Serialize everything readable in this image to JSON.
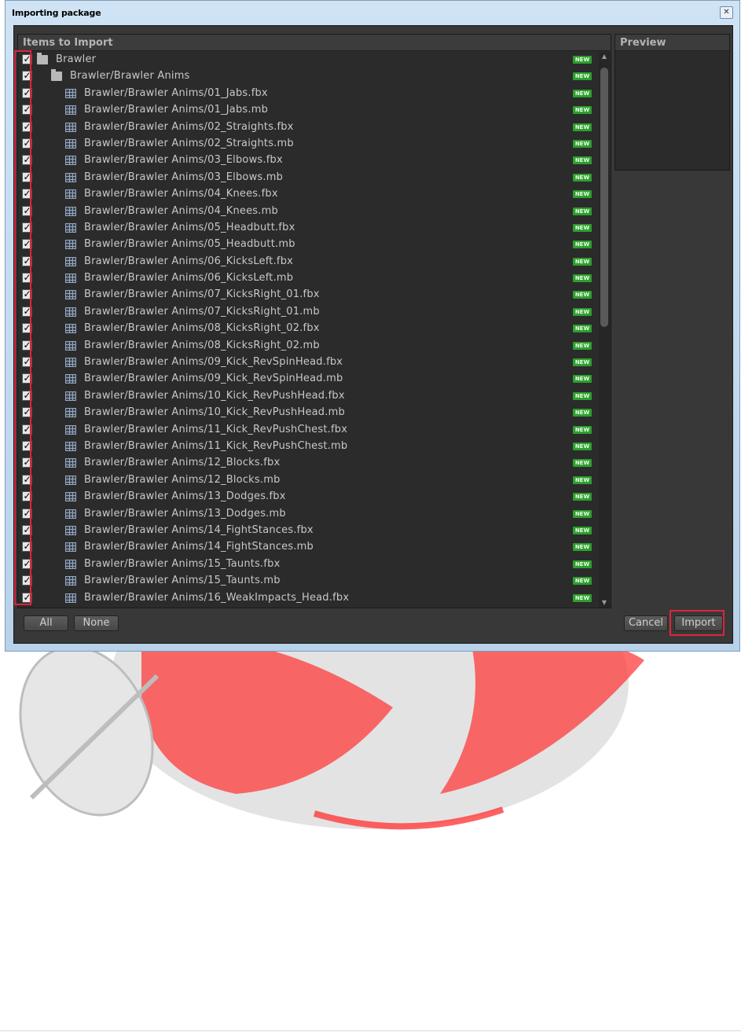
{
  "window": {
    "title": "Importing package",
    "close_glyph": "✕"
  },
  "items_panel": {
    "header": "Items to Import",
    "badge_text": "NEW"
  },
  "preview_panel": {
    "header": "Preview"
  },
  "items": [
    {
      "label": "Brawler",
      "type": "folder",
      "depth": 0,
      "checked": true
    },
    {
      "label": "Brawler/Brawler Anims",
      "type": "folder",
      "depth": 1,
      "checked": true
    },
    {
      "label": "Brawler/Brawler Anims/01_Jabs.fbx",
      "type": "file",
      "depth": 2,
      "checked": true
    },
    {
      "label": "Brawler/Brawler Anims/01_Jabs.mb",
      "type": "file",
      "depth": 2,
      "checked": true
    },
    {
      "label": "Brawler/Brawler Anims/02_Straights.fbx",
      "type": "file",
      "depth": 2,
      "checked": true
    },
    {
      "label": "Brawler/Brawler Anims/02_Straights.mb",
      "type": "file",
      "depth": 2,
      "checked": true
    },
    {
      "label": "Brawler/Brawler Anims/03_Elbows.fbx",
      "type": "file",
      "depth": 2,
      "checked": true
    },
    {
      "label": "Brawler/Brawler Anims/03_Elbows.mb",
      "type": "file",
      "depth": 2,
      "checked": true
    },
    {
      "label": "Brawler/Brawler Anims/04_Knees.fbx",
      "type": "file",
      "depth": 2,
      "checked": true
    },
    {
      "label": "Brawler/Brawler Anims/04_Knees.mb",
      "type": "file",
      "depth": 2,
      "checked": true
    },
    {
      "label": "Brawler/Brawler Anims/05_Headbutt.fbx",
      "type": "file",
      "depth": 2,
      "checked": true
    },
    {
      "label": "Brawler/Brawler Anims/05_Headbutt.mb",
      "type": "file",
      "depth": 2,
      "checked": true
    },
    {
      "label": "Brawler/Brawler Anims/06_KicksLeft.fbx",
      "type": "file",
      "depth": 2,
      "checked": true
    },
    {
      "label": "Brawler/Brawler Anims/06_KicksLeft.mb",
      "type": "file",
      "depth": 2,
      "checked": true
    },
    {
      "label": "Brawler/Brawler Anims/07_KicksRight_01.fbx",
      "type": "file",
      "depth": 2,
      "checked": true
    },
    {
      "label": "Brawler/Brawler Anims/07_KicksRight_01.mb",
      "type": "file",
      "depth": 2,
      "checked": true
    },
    {
      "label": "Brawler/Brawler Anims/08_KicksRight_02.fbx",
      "type": "file",
      "depth": 2,
      "checked": true
    },
    {
      "label": "Brawler/Brawler Anims/08_KicksRight_02.mb",
      "type": "file",
      "depth": 2,
      "checked": true
    },
    {
      "label": "Brawler/Brawler Anims/09_Kick_RevSpinHead.fbx",
      "type": "file",
      "depth": 2,
      "checked": true
    },
    {
      "label": "Brawler/Brawler Anims/09_Kick_RevSpinHead.mb",
      "type": "file",
      "depth": 2,
      "checked": true
    },
    {
      "label": "Brawler/Brawler Anims/10_Kick_RevPushHead.fbx",
      "type": "file",
      "depth": 2,
      "checked": true
    },
    {
      "label": "Brawler/Brawler Anims/10_Kick_RevPushHead.mb",
      "type": "file",
      "depth": 2,
      "checked": true
    },
    {
      "label": "Brawler/Brawler Anims/11_Kick_RevPushChest.fbx",
      "type": "file",
      "depth": 2,
      "checked": true
    },
    {
      "label": "Brawler/Brawler Anims/11_Kick_RevPushChest.mb",
      "type": "file",
      "depth": 2,
      "checked": true
    },
    {
      "label": "Brawler/Brawler Anims/12_Blocks.fbx",
      "type": "file",
      "depth": 2,
      "checked": true
    },
    {
      "label": "Brawler/Brawler Anims/12_Blocks.mb",
      "type": "file",
      "depth": 2,
      "checked": true
    },
    {
      "label": "Brawler/Brawler Anims/13_Dodges.fbx",
      "type": "file",
      "depth": 2,
      "checked": true
    },
    {
      "label": "Brawler/Brawler Anims/13_Dodges.mb",
      "type": "file",
      "depth": 2,
      "checked": true
    },
    {
      "label": "Brawler/Brawler Anims/14_FightStances.fbx",
      "type": "file",
      "depth": 2,
      "checked": true
    },
    {
      "label": "Brawler/Brawler Anims/14_FightStances.mb",
      "type": "file",
      "depth": 2,
      "checked": true
    },
    {
      "label": "Brawler/Brawler Anims/15_Taunts.fbx",
      "type": "file",
      "depth": 2,
      "checked": true
    },
    {
      "label": "Brawler/Brawler Anims/15_Taunts.mb",
      "type": "file",
      "depth": 2,
      "checked": true
    },
    {
      "label": "Brawler/Brawler Anims/16_WeakImpacts_Head.fbx",
      "type": "file",
      "depth": 2,
      "checked": true
    }
  ],
  "buttons": {
    "all": "All",
    "none": "None",
    "cancel": "Cancel",
    "import": "Import"
  },
  "colors": {
    "badge": "#2e9e2e",
    "highlight": "#e0243a",
    "panel_bg": "#2b2b2b"
  },
  "icons": {
    "folder": "folder-icon",
    "file": "mesh-file-icon",
    "check": "checkmark-icon"
  }
}
